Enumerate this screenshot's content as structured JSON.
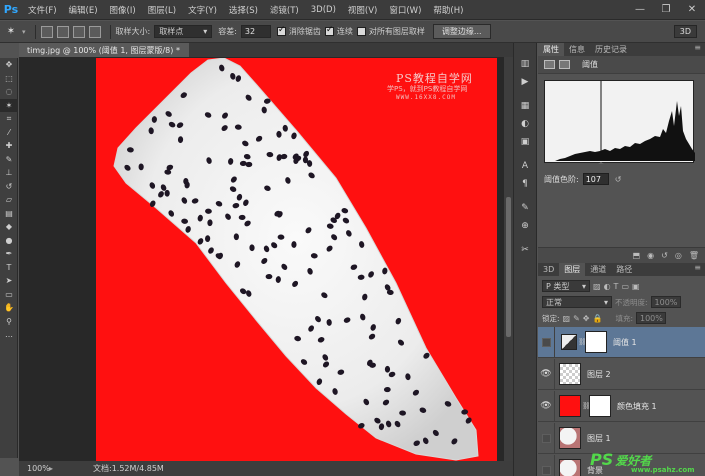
{
  "app": {
    "logo": "Ps"
  },
  "menus": [
    "文件(F)",
    "编辑(E)",
    "图像(I)",
    "图层(L)",
    "文字(Y)",
    "选择(S)",
    "滤镜(T)",
    "3D(D)",
    "视图(V)",
    "窗口(W)",
    "帮助(H)"
  ],
  "window": {
    "minimize": "—",
    "restore": "❐",
    "close": "✕"
  },
  "options": {
    "sample_size_label": "取样大小:",
    "sample_size_value": "取样点",
    "tolerance_label": "容差:",
    "tolerance_value": "32",
    "antialias_label": "消除锯齿",
    "antialias_checked": true,
    "contiguous_label": "连续",
    "contiguous_checked": true,
    "all_layers_label": "对所有图层取样",
    "all_layers_checked": false,
    "refine_edge_label": "调整边缘...",
    "mode_3d": "3D"
  },
  "document": {
    "tab_title": "timg.jpg @ 100% (阈值 1, 图层蒙版/8) *",
    "watermark_title": "PS教程自学网",
    "watermark_sub": "学PS，就到PS教程自学网",
    "watermark_url": "WWW.16XX8.COM"
  },
  "status": {
    "zoom": "100%",
    "doc_info": "文档:1.52M/4.85M"
  },
  "properties_panel": {
    "tabs": [
      "属性",
      "信息",
      "历史记录"
    ],
    "title": "阈值",
    "threshold_label": "阈值色阶:",
    "threshold_value": "107"
  },
  "layers_panel": {
    "tabs": [
      "3D",
      "图层",
      "通道",
      "路径"
    ],
    "kind_label": "P 类型",
    "blend_mode": "正常",
    "opacity_label": "不透明度:",
    "opacity_value": "100%",
    "lock_label": "锁定:",
    "fill_label": "填充:",
    "fill_value": "100%",
    "layers": [
      {
        "name": "阈值 1",
        "visible": false,
        "selected": true,
        "type": "adjustment",
        "has_mask": true
      },
      {
        "name": "图层 2",
        "visible": true,
        "selected": false,
        "type": "transparent",
        "has_mask": false
      },
      {
        "name": "颜色填充 1",
        "visible": true,
        "selected": false,
        "type": "fill",
        "has_mask": true
      },
      {
        "name": "图层 1",
        "visible": false,
        "selected": false,
        "type": "photo",
        "has_mask": false
      },
      {
        "name": "背景",
        "visible": false,
        "selected": false,
        "type": "photo",
        "has_mask": false
      }
    ]
  },
  "site_watermark": {
    "ps": "PS",
    "name": "爱好者",
    "url": "www.psahz.com"
  },
  "colors": {
    "canvas_bg": "#ff1010",
    "selection_blue": "#5d7796",
    "logo_blue": "#31a8ff",
    "watermark_green": "#53d84b"
  }
}
